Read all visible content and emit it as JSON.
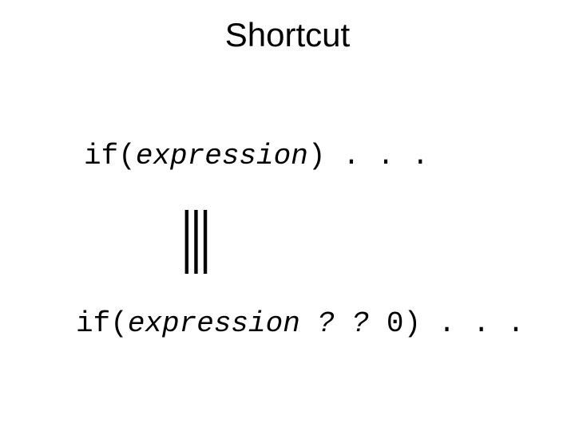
{
  "title": "Shortcut",
  "line1": {
    "if": "if(",
    "expr": "expression",
    "close": ") ",
    "dots": ". . ."
  },
  "symbol": "|||",
  "line2": {
    "if": "if(",
    "expr": "expression",
    "qq": " ? ? ",
    "zero": "0) ",
    "dots": ". . ."
  }
}
